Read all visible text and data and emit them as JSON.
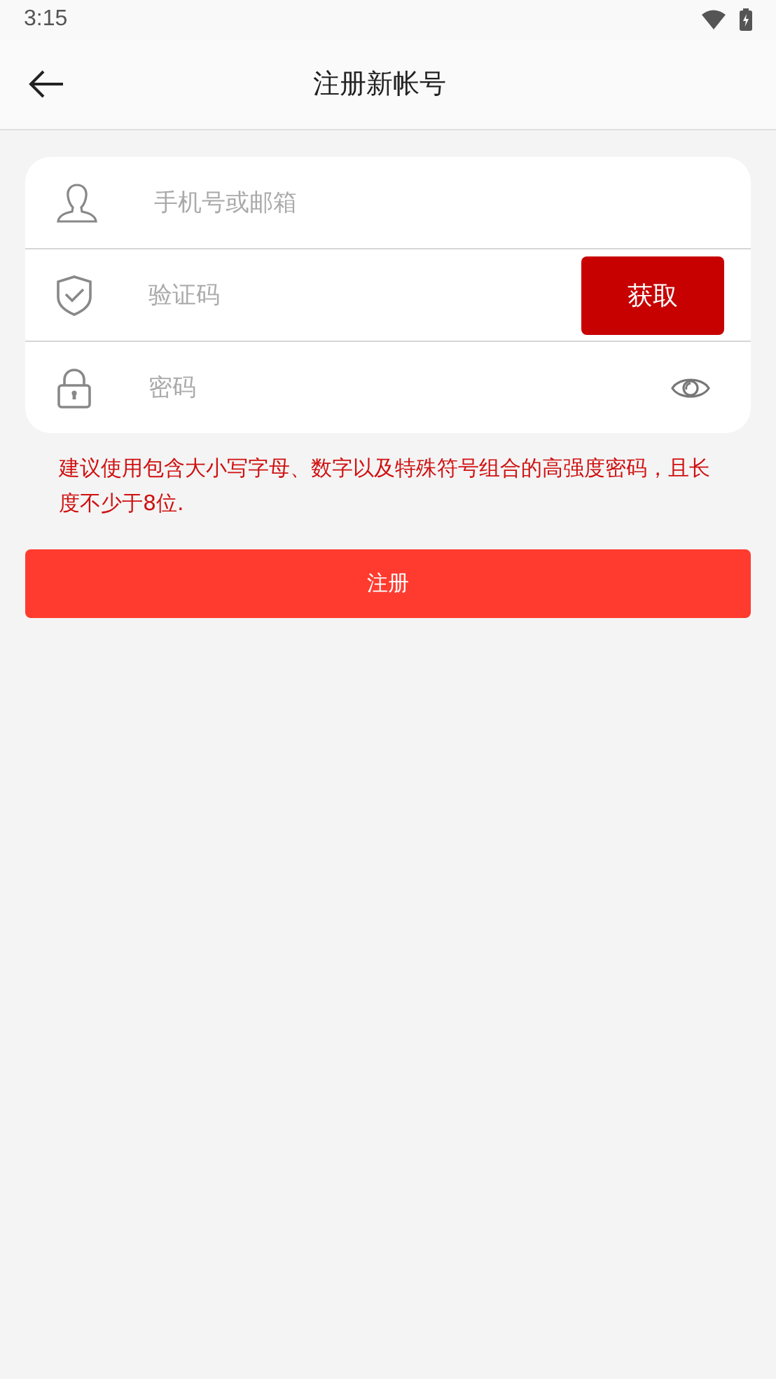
{
  "status_bar": {
    "time": "3:15"
  },
  "header": {
    "title": "注册新帐号"
  },
  "fields": [
    {
      "kind": "account",
      "placeholder": "手机号或邮箱"
    },
    {
      "kind": "code",
      "placeholder": "验证码",
      "button": "获取"
    },
    {
      "kind": "password",
      "placeholder": "密码"
    }
  ],
  "hint": "建议使用包含大小写字母、数字以及特殊符号组合的高强度密码，且长度不少于8位.",
  "submit": "注册"
}
